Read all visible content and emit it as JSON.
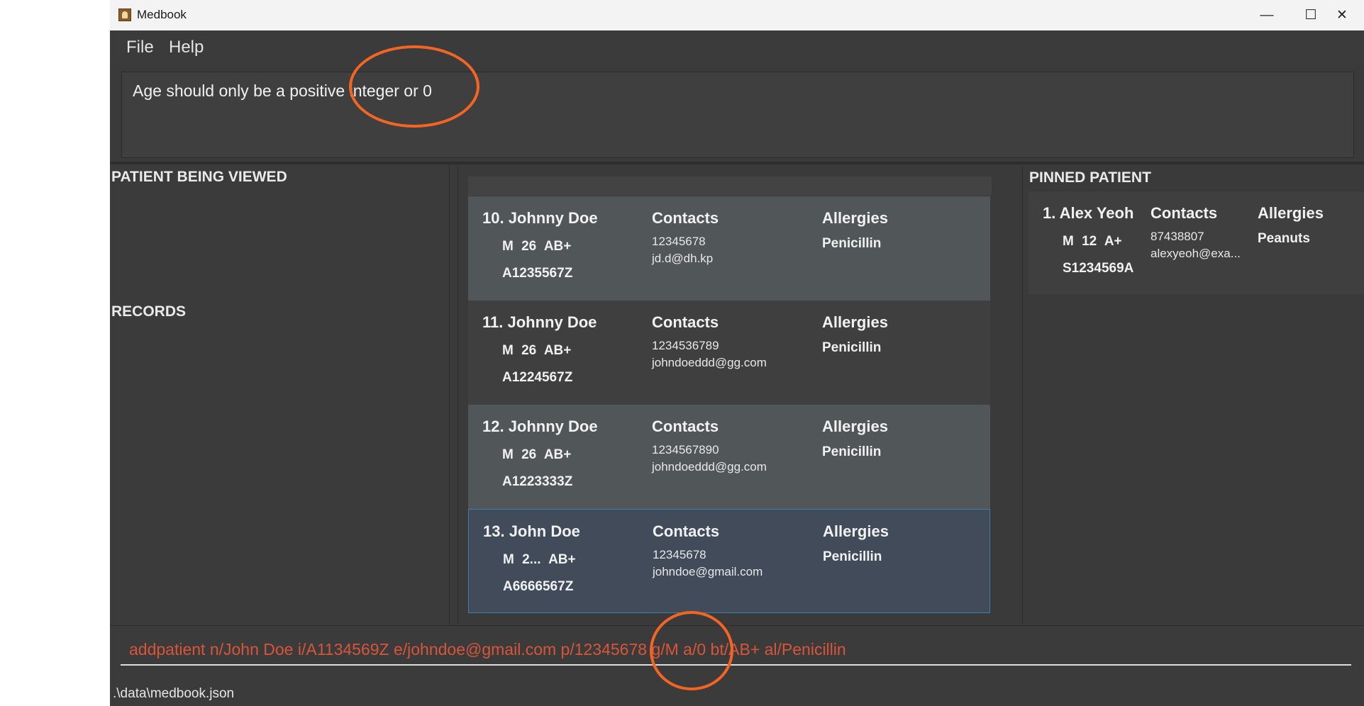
{
  "window": {
    "title": "Medbook",
    "minimize_icon": "minimize-icon",
    "maximize_icon": "maximize-icon",
    "close_icon": "close-icon",
    "minimize_glyph": "—",
    "maximize_glyph": "☐",
    "close_glyph": "✕"
  },
  "menu": {
    "file": "File",
    "help": "Help"
  },
  "result": {
    "message": "Age should only be a positive integer or 0"
  },
  "left": {
    "viewing_header": "PATIENT BEING VIEWED",
    "records_header": "RECORDS"
  },
  "patients": [
    {
      "name": "10. Johnny Doe",
      "tags": "M 26 AB+",
      "nric": "A1235567Z",
      "contacts_label": "Contacts",
      "phone": "12345678",
      "email": "jd.d@dh.kp",
      "allergies_label": "Allergies",
      "allergy": "Penicillin"
    },
    {
      "name": "11. Johnny Doe",
      "tags": "M 26 AB+",
      "nric": "A1224567Z",
      "contacts_label": "Contacts",
      "phone": "1234536789",
      "email": "johndoeddd@gg.com",
      "allergies_label": "Allergies",
      "allergy": "Penicillin"
    },
    {
      "name": "12. Johnny Doe",
      "tags": "M 26 AB+",
      "nric": "A1223333Z",
      "contacts_label": "Contacts",
      "phone": "1234567890",
      "email": "johndoeddd@gg.com",
      "allergies_label": "Allergies",
      "allergy": "Penicillin"
    },
    {
      "name": "13. John Doe",
      "tags": "M 2... AB+",
      "nric": "A6666567Z",
      "contacts_label": "Contacts",
      "phone": "12345678",
      "email": "johndoe@gmail.com",
      "allergies_label": "Allergies",
      "allergy": "Penicillin"
    }
  ],
  "pinned": {
    "header": "PINNED PATIENT",
    "patient": {
      "name": "1. Alex Yeoh",
      "tags": "M 12 A+",
      "nric": "S1234569A",
      "contacts_label": "Contacts",
      "phone": "87438807",
      "email": "alexyeoh@exa...",
      "allergies_label": "Allergies",
      "allergy": "Peanuts"
    }
  },
  "command": {
    "value": "addpatient n/John Doe i/A1134569Z e/johndoe@gmail.com p/12345678 g/M a/0 bt/AB+ al/Penicillin"
  },
  "status": {
    "path": ".\\data\\medbook.json"
  },
  "colors": {
    "accent_error": "#d8553a",
    "annotation": "#f26522",
    "selected_border": "#3d7fa6"
  }
}
